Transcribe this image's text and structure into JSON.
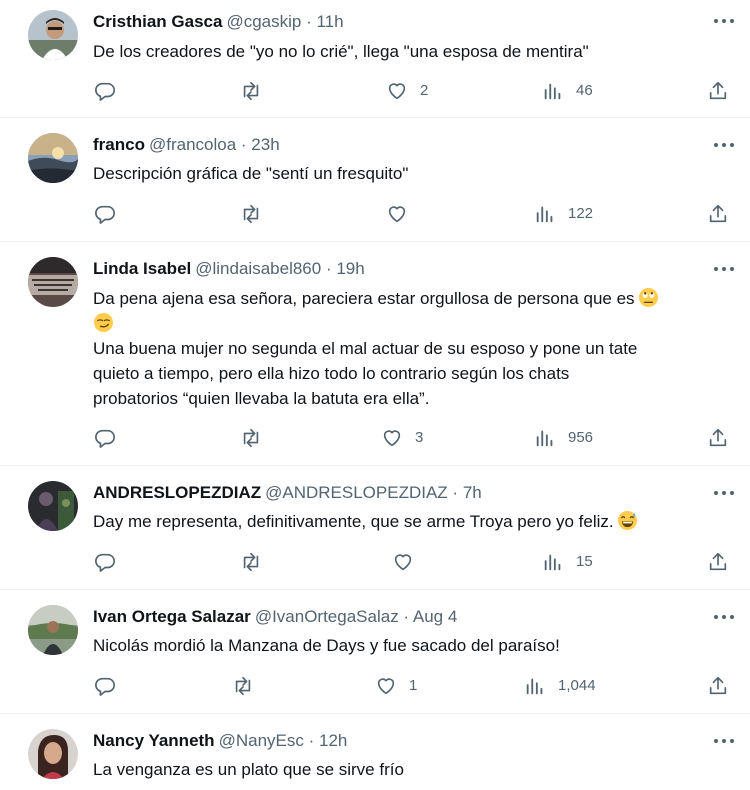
{
  "tweets": [
    {
      "name": "Cristhian Gasca",
      "handle": "@cgaskip",
      "time": "11h",
      "lines": [
        "De los creadores de \"yo no lo crié\", llega \"una esposa de mentira\""
      ],
      "emojis": [],
      "likes": "2",
      "views": "46",
      "avatar": "man-portrait"
    },
    {
      "name": "franco",
      "handle": "@francoloa",
      "time": "23h",
      "lines": [
        "Descripción gráfica de \"sentí un fresquito\""
      ],
      "emojis": [],
      "likes": "",
      "views": "122",
      "avatar": "sunset-landscape"
    },
    {
      "name": "Linda Isabel",
      "handle": "@lindaisabel860",
      "time": "19h",
      "lines": [
        "Da pena ajena esa señora, pareciera estar orgullosa de persona que es",
        "",
        "Una buena mujer no segunda el mal actuar de su esposo y pone un tate",
        "quieto a tiempo, pero ella hizo todo lo contrario según los chats",
        "probatorios “quien llevaba la  batuta era ella”."
      ],
      "emojis": [
        "eye-roll-emoji",
        "smirk-emoji"
      ],
      "likes": "3",
      "views": "956",
      "avatar": "text-sign-image"
    },
    {
      "name": "ANDRESLOPEZDIAZ",
      "handle": "@ANDRESLOPEZDIAZ",
      "time": "7h",
      "lines": [
        "Day me representa, definitivamente, que se arme Troya pero yo feliz."
      ],
      "emojis": [
        "grinning-sweat-emoji"
      ],
      "likes": "",
      "views": "15",
      "avatar": "dark-scene"
    },
    {
      "name": "Ivan Ortega Salazar",
      "handle": "@IvanOrtegaSalaz",
      "time": "Aug 4",
      "lines": [
        "Nicolás mordió la Manzana de Days y fue sacado del paraíso!"
      ],
      "emojis": [],
      "likes": "1",
      "views": "1,044",
      "avatar": "person-outdoors"
    },
    {
      "name": "Nancy Yanneth",
      "handle": "@NanyEsc",
      "time": "12h",
      "lines": [
        "La venganza es un plato que se sirve frío"
      ],
      "emojis": [],
      "likes": "",
      "views": "",
      "avatar": "woman-portrait"
    }
  ],
  "colors": {
    "text": "#0f1419",
    "secondary": "#536471",
    "divider": "#eff3f4",
    "emoji_yellow": "#ffcc4d"
  }
}
